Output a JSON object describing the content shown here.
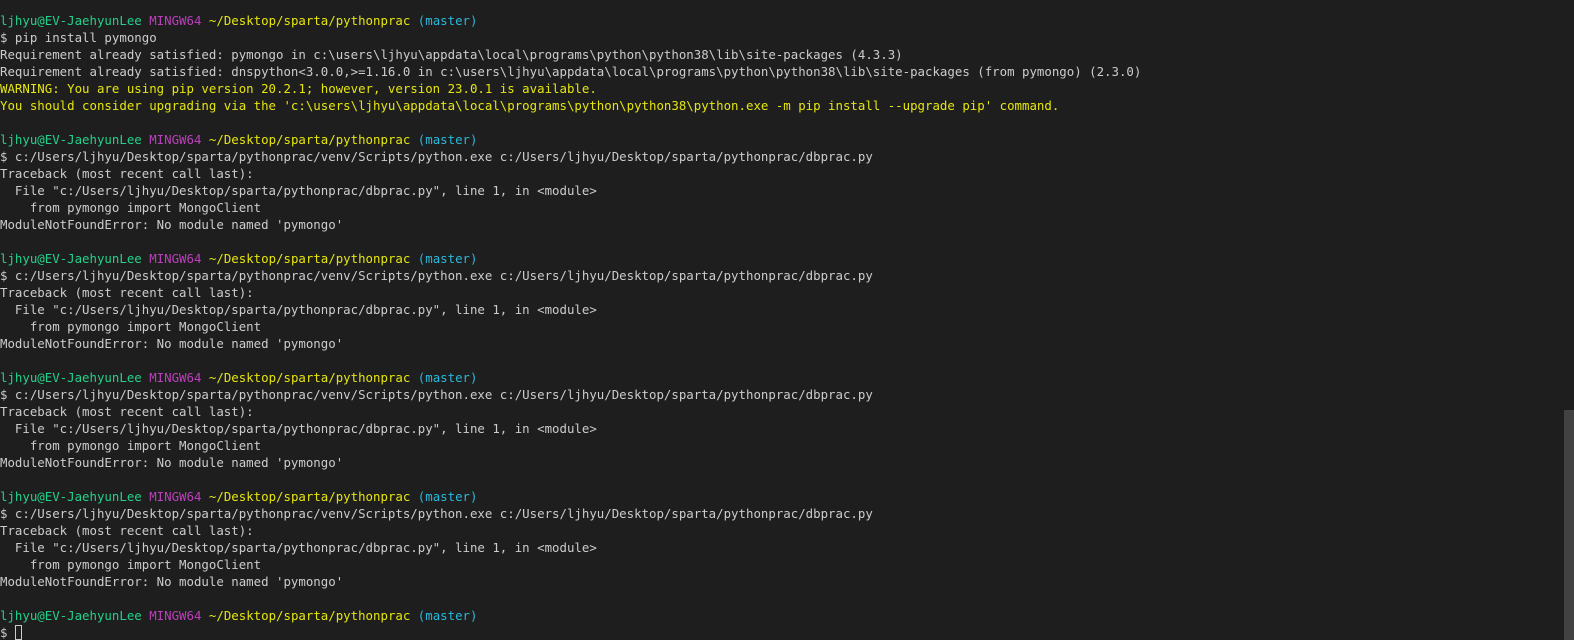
{
  "prompt": {
    "user_host": "ljhyu@EV-JaehyunLee",
    "shell": "MINGW64",
    "path": "~/Desktop/sparta/pythonprac",
    "branch": "(master)",
    "symbol": "$"
  },
  "lines": [
    {
      "type": "prompt"
    },
    {
      "type": "text",
      "text": "$ pip install pymongo"
    },
    {
      "type": "text",
      "text": "Requirement already satisfied: pymongo in c:\\users\\ljhyu\\appdata\\local\\programs\\python\\python38\\lib\\site-packages (4.3.3)"
    },
    {
      "type": "text",
      "text": "Requirement already satisfied: dnspython<3.0.0,>=1.16.0 in c:\\users\\ljhyu\\appdata\\local\\programs\\python\\python38\\lib\\site-packages (from pymongo) (2.3.0)"
    },
    {
      "type": "warn",
      "text": "WARNING: You are using pip version 20.2.1; however, version 23.0.1 is available."
    },
    {
      "type": "warn",
      "text": "You should consider upgrading via the 'c:\\users\\ljhyu\\appdata\\local\\programs\\python\\python38\\python.exe -m pip install --upgrade pip' command."
    },
    {
      "type": "blank"
    },
    {
      "type": "prompt"
    },
    {
      "type": "text",
      "text": "$ c:/Users/ljhyu/Desktop/sparta/pythonprac/venv/Scripts/python.exe c:/Users/ljhyu/Desktop/sparta/pythonprac/dbprac.py"
    },
    {
      "type": "text",
      "text": "Traceback (most recent call last):"
    },
    {
      "type": "text",
      "text": "  File \"c:/Users/ljhyu/Desktop/sparta/pythonprac/dbprac.py\", line 1, in <module>"
    },
    {
      "type": "text",
      "text": "    from pymongo import MongoClient"
    },
    {
      "type": "text",
      "text": "ModuleNotFoundError: No module named 'pymongo'"
    },
    {
      "type": "blank"
    },
    {
      "type": "prompt"
    },
    {
      "type": "text",
      "text": "$ c:/Users/ljhyu/Desktop/sparta/pythonprac/venv/Scripts/python.exe c:/Users/ljhyu/Desktop/sparta/pythonprac/dbprac.py"
    },
    {
      "type": "text",
      "text": "Traceback (most recent call last):"
    },
    {
      "type": "text",
      "text": "  File \"c:/Users/ljhyu/Desktop/sparta/pythonprac/dbprac.py\", line 1, in <module>"
    },
    {
      "type": "text",
      "text": "    from pymongo import MongoClient"
    },
    {
      "type": "text",
      "text": "ModuleNotFoundError: No module named 'pymongo'"
    },
    {
      "type": "blank"
    },
    {
      "type": "prompt"
    },
    {
      "type": "text",
      "text": "$ c:/Users/ljhyu/Desktop/sparta/pythonprac/venv/Scripts/python.exe c:/Users/ljhyu/Desktop/sparta/pythonprac/dbprac.py"
    },
    {
      "type": "text",
      "text": "Traceback (most recent call last):"
    },
    {
      "type": "text",
      "text": "  File \"c:/Users/ljhyu/Desktop/sparta/pythonprac/dbprac.py\", line 1, in <module>"
    },
    {
      "type": "text",
      "text": "    from pymongo import MongoClient"
    },
    {
      "type": "text",
      "text": "ModuleNotFoundError: No module named 'pymongo'"
    },
    {
      "type": "blank"
    },
    {
      "type": "prompt"
    },
    {
      "type": "text",
      "text": "$ c:/Users/ljhyu/Desktop/sparta/pythonprac/venv/Scripts/python.exe c:/Users/ljhyu/Desktop/sparta/pythonprac/dbprac.py"
    },
    {
      "type": "text",
      "text": "Traceback (most recent call last):"
    },
    {
      "type": "text",
      "text": "  File \"c:/Users/ljhyu/Desktop/sparta/pythonprac/dbprac.py\", line 1, in <module>"
    },
    {
      "type": "text",
      "text": "    from pymongo import MongoClient"
    },
    {
      "type": "text",
      "text": "ModuleNotFoundError: No module named 'pymongo'"
    },
    {
      "type": "blank"
    },
    {
      "type": "prompt"
    },
    {
      "type": "input",
      "text": "$ "
    }
  ],
  "colors": {
    "background": "#1e1e1e",
    "text": "#cccccc",
    "user_host": "#23d18b",
    "shell": "#bc3fbc",
    "path": "#e5e510",
    "branch": "#29b8db",
    "warning": "#e5e510",
    "scrollbar_thumb": "#424242"
  }
}
